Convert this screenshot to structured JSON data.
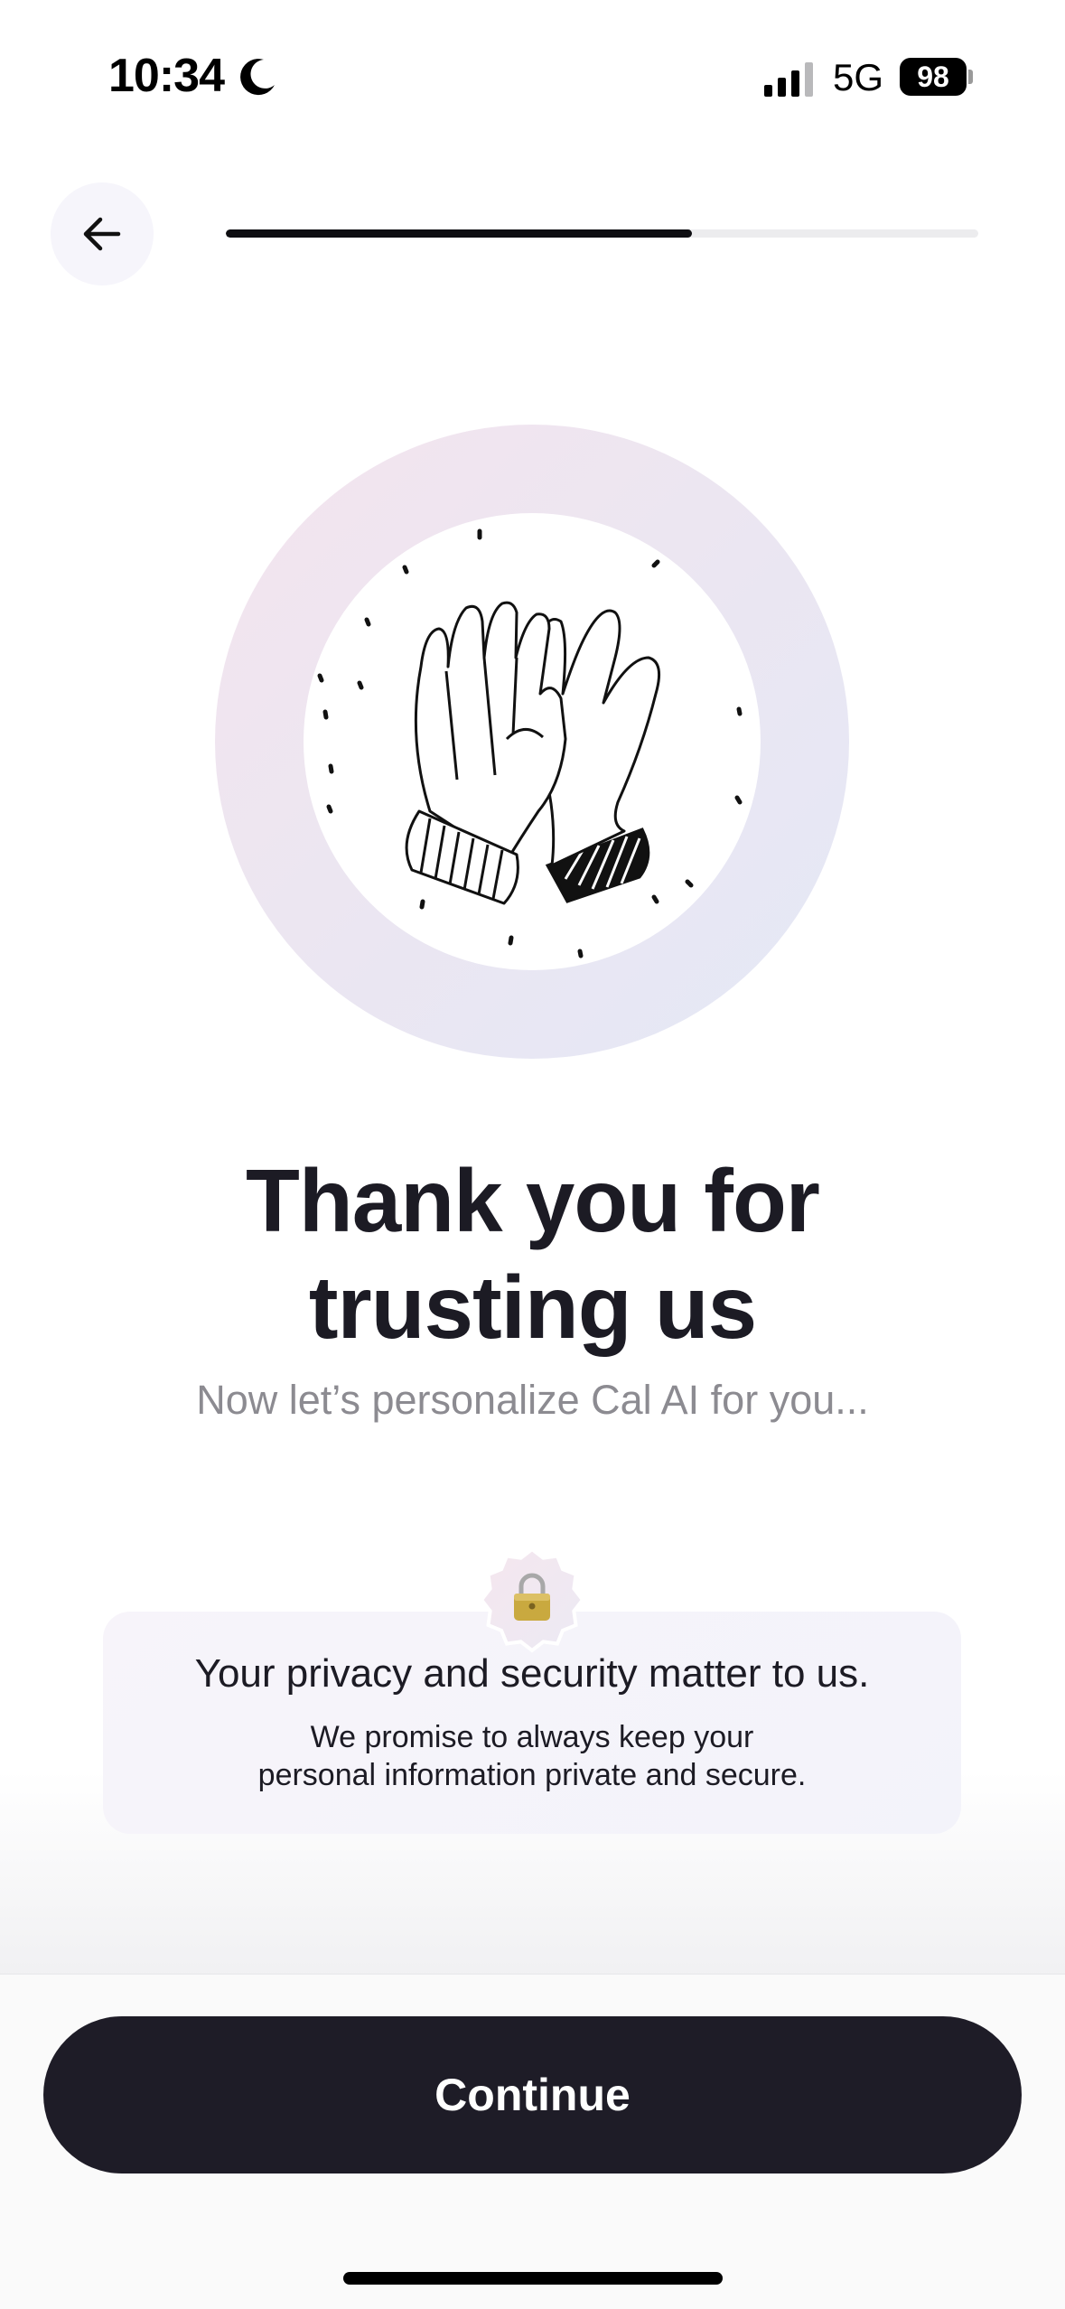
{
  "status_bar": {
    "time": "10:34",
    "network": "5G",
    "battery": "98",
    "icons": [
      "moon-icon",
      "signal-icon",
      "battery-icon"
    ]
  },
  "header": {
    "back_icon": "arrow-left-icon",
    "progress": 0.62
  },
  "illustration": {
    "icon": "high-five-gloves-icon"
  },
  "main": {
    "title_line1": "Thank you for",
    "title_line2": "trusting us",
    "subtitle": "Now let’s personalize Cal AI for you..."
  },
  "privacy": {
    "badge_icon": "lock-icon",
    "title": "Your privacy and security matter to us.",
    "body_line1": "We promise to always keep your",
    "body_line2": "personal information private and secure."
  },
  "footer": {
    "continue_label": "Continue"
  },
  "colors": {
    "primary_dark": "#1e1c27",
    "progress_track": "#ececee",
    "subtitle_gray": "#8c8b91",
    "ring_pink": "#f4e4ee",
    "ring_blue": "#e4e8f6"
  }
}
